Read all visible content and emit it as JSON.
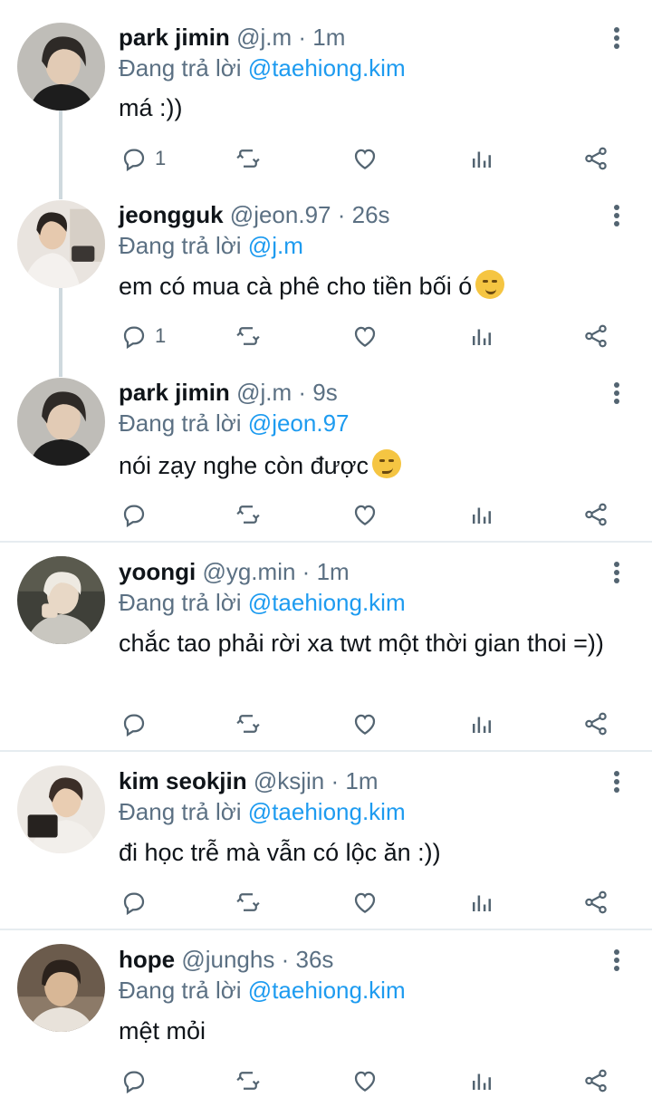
{
  "tweets": [
    {
      "name": "park jimin",
      "handle": "@j.m",
      "dot": "·",
      "time": "1m",
      "reply_prefix": "Đang trả lời",
      "reply_to": "@taehiong.kim",
      "text": "má :))",
      "reply_count": "1"
    },
    {
      "name": "jeongguk",
      "handle": "@jeon.97",
      "dot": "·",
      "time": "26s",
      "reply_prefix": "Đang trả lời",
      "reply_to": "@j.m",
      "text": "em có mua cà phê cho tiền bối ó",
      "reply_count": "1"
    },
    {
      "name": "park jimin",
      "handle": "@j.m",
      "dot": "·",
      "time": "9s",
      "reply_prefix": "Đang trả lời",
      "reply_to": "@jeon.97",
      "text": "nói zạy nghe còn được",
      "reply_count": ""
    },
    {
      "name": "yoongi",
      "handle": "@yg.min",
      "dot": "·",
      "time": "1m",
      "reply_prefix": "Đang trả lời",
      "reply_to": "@taehiong.kim",
      "text": "chắc tao phải rời xa twt một thời gian thoi =))",
      "reply_count": ""
    },
    {
      "name": "kim seokjin",
      "handle": "@ksjin",
      "dot": "·",
      "time": "1m",
      "reply_prefix": "Đang trả lời",
      "reply_to": "@taehiong.kim",
      "text": "đi học trễ mà vẫn có lộc ăn :))",
      "reply_count": ""
    },
    {
      "name": "hope",
      "handle": "@junghs",
      "dot": "·",
      "time": "36s",
      "reply_prefix": "Đang trả lời",
      "reply_to": "@taehiong.kim",
      "text": "mệt mỏi",
      "reply_count": ""
    }
  ],
  "icons": {
    "reply": "reply-icon",
    "retweet": "retweet-icon",
    "like": "heart-icon",
    "stats": "stats-icon",
    "share": "share-icon",
    "more": "more-vertical-icon"
  },
  "colors": {
    "mention": "#1d9bf0",
    "muted": "#5b7083",
    "thread_line": "#cfd9de"
  }
}
